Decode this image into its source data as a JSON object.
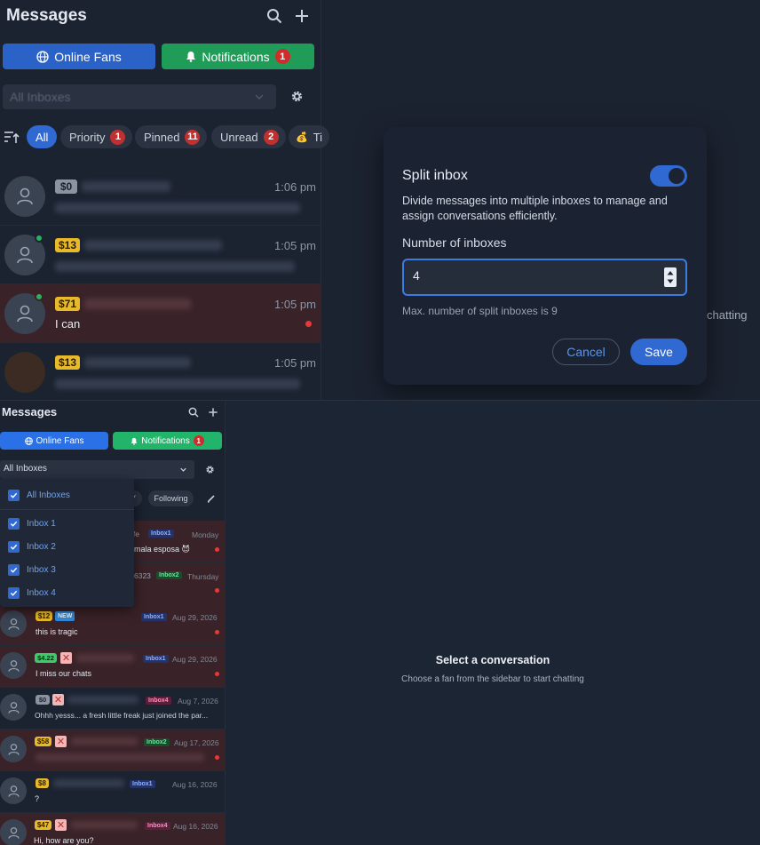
{
  "top": {
    "title": "Messages",
    "online_fans": "Online Fans",
    "notifications": "Notifications",
    "notifications_count": "1",
    "inbox_select": "All Inboxes",
    "filters": [
      {
        "label": "All"
      },
      {
        "label": "Priority",
        "count": "1"
      },
      {
        "label": "Pinned",
        "count": "11"
      },
      {
        "label": "Unread",
        "count": "2"
      },
      {
        "label": "Ti"
      }
    ],
    "rows": [
      {
        "price": "$0",
        "time": "1:06 pm",
        "message": ""
      },
      {
        "price": "$13",
        "time": "1:05 pm",
        "message": ""
      },
      {
        "price": "$71",
        "time": "1:05 pm",
        "message": "I can"
      },
      {
        "price": "$13",
        "time": "1:05 pm",
        "message": ""
      }
    ]
  },
  "modal": {
    "title": "Split inbox",
    "description": "Divide messages into multiple inboxes to manage and assign conversations efficiently.",
    "number_label": "Number of inboxes",
    "number_value": "4",
    "hint": "Max. number of split inboxes is 9",
    "cancel": "Cancel",
    "save": "Save",
    "background_text": "chatting"
  },
  "bottom": {
    "title": "Messages",
    "online_fans": "Online Fans",
    "notifications": "Notifications",
    "notifications_count": "1",
    "inbox_select": "All Inboxes",
    "chips": [
      "Y",
      "Following"
    ],
    "dropdown": {
      "all": "All Inboxes",
      "items": [
        "Inbox 1",
        "Inbox 2",
        "Inbox 3",
        "Inbox 4"
      ]
    },
    "rows": [
      {
        "fragment": "ife",
        "inbox": "Inbox1",
        "time": "Monday",
        "message": "mala esposa 😈"
      },
      {
        "fragment": "6323",
        "inbox": "Inbox2",
        "time": "Thursday",
        "message": ""
      },
      {
        "price": "$12",
        "badge": "NEW",
        "inbox": "Inbox1",
        "time": "Aug 29, 2026",
        "message": "this is tragic"
      },
      {
        "price": "$4.22",
        "inbox": "Inbox1",
        "time": "Aug 29, 2026",
        "message": "I miss our chats"
      },
      {
        "price": "$0",
        "inbox": "Inbox4",
        "time": "Aug 7, 2026",
        "message": "Ohhh yesss... a fresh little freak just joined the par..."
      },
      {
        "price": "$58",
        "inbox": "Inbox2",
        "time": "Aug 17, 2026",
        "message": ""
      },
      {
        "price": "$8",
        "inbox": "Inbox1",
        "time": "Aug 16, 2026",
        "message": "?"
      },
      {
        "price": "$47",
        "inbox": "Inbox4",
        "time": "Aug 16, 2026",
        "message": "Hi, how are you?"
      }
    ],
    "empty_title": "Select a conversation",
    "empty_subtitle": "Choose a fan from the sidebar to start chatting"
  },
  "colors": {
    "accent_blue": "#2f69d1",
    "notify_green": "#1f9d58",
    "badge_red": "#d12b2b",
    "highlight_row": "#3a2328"
  }
}
